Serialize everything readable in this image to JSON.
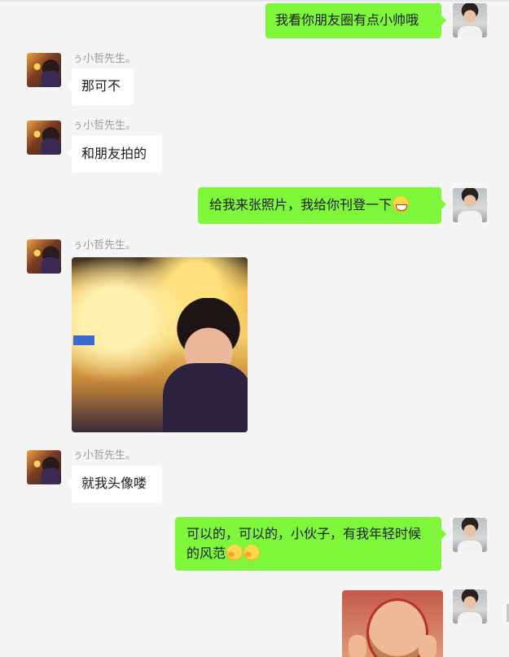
{
  "contact": {
    "nickname": "ぅ小哲先生。"
  },
  "messages": [
    {
      "side": "right",
      "text": "我看你朋友圈有点小帅哦"
    },
    {
      "side": "left",
      "text": "那可不"
    },
    {
      "side": "left",
      "text": "和朋友拍的"
    },
    {
      "side": "right",
      "text": "给我来张照片，我给你刊登一下"
    },
    {
      "side": "left",
      "type": "image"
    },
    {
      "side": "left",
      "text": "就我头像喽"
    },
    {
      "side": "right",
      "text": "可以的，可以的，小伙子，有我年轻时候的风范"
    },
    {
      "side": "right",
      "type": "sticker"
    }
  ],
  "icons": {
    "grin_emoji": "grinning-face-emoji",
    "shy_emoji": "hand-over-mouth-emoji"
  },
  "colors": {
    "background": "#f5f5f5",
    "self_bubble": "#7ef73b",
    "other_bubble": "#ffffff",
    "nickname": "#9b9b9b"
  }
}
